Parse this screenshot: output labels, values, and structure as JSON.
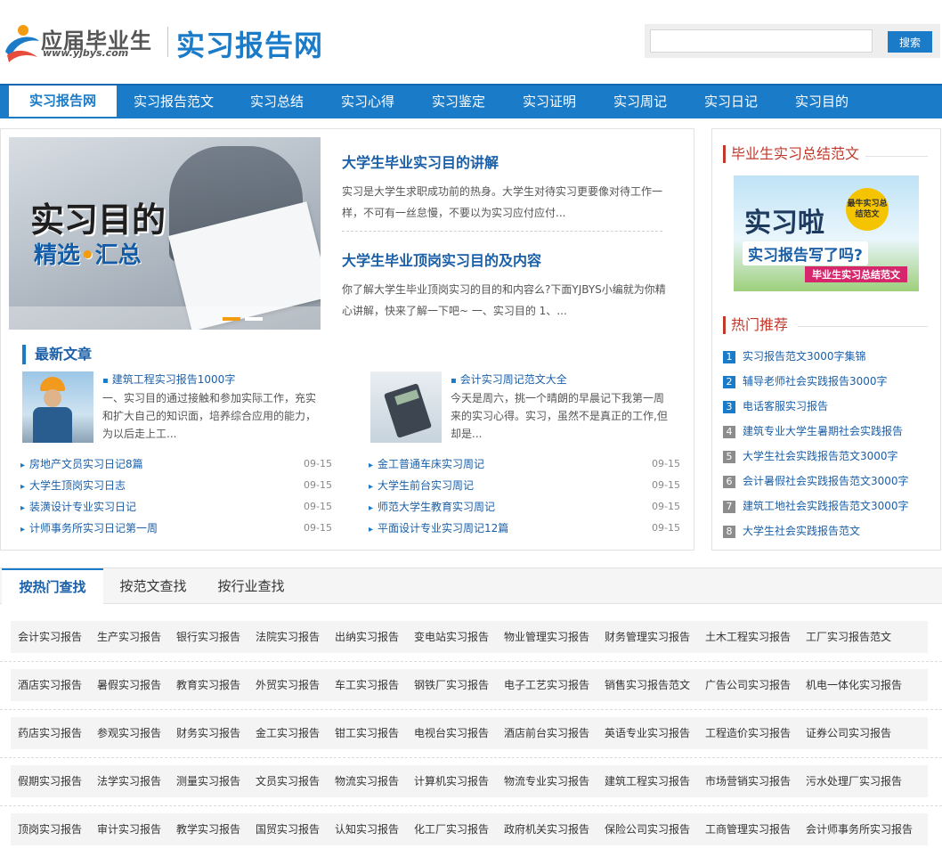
{
  "header": {
    "logo_main": "应届毕业生",
    "logo_sub": "www.yjbys.com",
    "site_title": "实习报告网",
    "search_placeholder": "",
    "search_button": "搜索",
    "colors": {
      "brand": "#1a7bc9",
      "accent_red": "#c0392b"
    }
  },
  "nav": {
    "items": [
      {
        "label": "实习报告网",
        "active": true
      },
      {
        "label": "实习报告范文"
      },
      {
        "label": "实习总结"
      },
      {
        "label": "实习心得"
      },
      {
        "label": "实习鉴定"
      },
      {
        "label": "实习证明"
      },
      {
        "label": "实习周记"
      },
      {
        "label": "实习日记"
      },
      {
        "label": "实习目的"
      }
    ]
  },
  "banner": {
    "title": "实习目的",
    "subtitle_a": "精选",
    "subtitle_b": "汇总"
  },
  "features": [
    {
      "title": "大学生毕业实习目的讲解",
      "desc": "实习是大学生求职成功前的热身。大学生对待实习更要像对待工作一样，不可有一丝怠慢，不要以为实习应付应付..."
    },
    {
      "title": "大学生毕业顶岗实习目的及内容",
      "desc": "你了解大学生毕业顶岗实习的目的和内容么?下面YJBYS小编就为你精心讲解，快来了解一下吧~ 一、实习目的 1、..."
    }
  ],
  "latest": {
    "heading": "最新文章",
    "cards": [
      {
        "title": "建筑工程实习报告1000字",
        "desc": "一、实习目的通过接触和参加实际工作，充实和扩大自己的知识面，培养综合应用的能力，为以后走上工...",
        "icon": "construction-worker-icon"
      },
      {
        "title": "会计实习周记范文大全",
        "desc": "今天是周六，挑一个晴朗的早晨记下我第一周来的实习心得。实习，虽然不是真正的工作,但却是...",
        "icon": "calculator-icon"
      }
    ],
    "list_left": [
      {
        "title": "房地产文员实习日记8篇",
        "date": "09-15"
      },
      {
        "title": "大学生顶岗实习日志",
        "date": "09-15"
      },
      {
        "title": "装潢设计专业实习日记",
        "date": "09-15"
      },
      {
        "title": "计师事务所实习日记第一周",
        "date": "09-15"
      }
    ],
    "list_right": [
      {
        "title": "金工普通车床实习周记",
        "date": "09-15"
      },
      {
        "title": "大学生前台实习周记",
        "date": "09-15"
      },
      {
        "title": "师范大学生教育实习周记",
        "date": "09-15"
      },
      {
        "title": "平面设计专业实习周记12篇",
        "date": "09-15"
      }
    ]
  },
  "sidebar": {
    "summary_heading": "毕业生实习总结范文",
    "side_banner": {
      "title": "实习啦",
      "question": "实习报告写了吗?",
      "badge": "最牛实习总结范文",
      "strip": "毕业生实习总结范文"
    },
    "hot_heading": "热门推荐",
    "hot": [
      {
        "num": "1",
        "title": "实习报告范文3000字集锦"
      },
      {
        "num": "2",
        "title": "辅导老师社会实践报告3000字"
      },
      {
        "num": "3",
        "title": "电话客服实习报告"
      },
      {
        "num": "4",
        "title": "建筑专业大学生暑期社会实践报告"
      },
      {
        "num": "5",
        "title": "大学生社会实践报告范文3000字"
      },
      {
        "num": "6",
        "title": "会计暑假社会实践报告范文3000字"
      },
      {
        "num": "7",
        "title": "建筑工地社会实践报告范文3000字"
      },
      {
        "num": "8",
        "title": "大学生社会实践报告范文"
      }
    ]
  },
  "tabs": {
    "items": [
      {
        "label": "按热门查找",
        "active": true
      },
      {
        "label": "按范文查找"
      },
      {
        "label": "按行业查找"
      }
    ],
    "rows": [
      [
        "会计实习报告",
        "生产实习报告",
        "银行实习报告",
        "法院实习报告",
        "出纳实习报告",
        "变电站实习报告",
        "物业管理实习报告",
        "财务管理实习报告",
        "土木工程实习报告",
        "工厂实习报告范文"
      ],
      [
        "酒店实习报告",
        "暑假实习报告",
        "教育实习报告",
        "外贸实习报告",
        "车工实习报告",
        "钢铁厂实习报告",
        "电子工艺实习报告",
        "销售实习报告范文",
        "广告公司实习报告",
        "机电一体化实习报告"
      ],
      [
        "药店实习报告",
        "参观实习报告",
        "财务实习报告",
        "金工实习报告",
        "钳工实习报告",
        "电视台实习报告",
        "酒店前台实习报告",
        "英语专业实习报告",
        "工程造价实习报告",
        "证券公司实习报告"
      ],
      [
        "假期实习报告",
        "法学实习报告",
        "测量实习报告",
        "文员实习报告",
        "物流实习报告",
        "计算机实习报告",
        "物流专业实习报告",
        "建筑工程实习报告",
        "市场营销实习报告",
        "污水处理厂实习报告"
      ],
      [
        "顶岗实习报告",
        "审计实习报告",
        "教学实习报告",
        "国贸实习报告",
        "认知实习报告",
        "化工厂实习报告",
        "政府机关实习报告",
        "保险公司实习报告",
        "工商管理实习报告",
        "会计师事务所实习报告"
      ]
    ]
  }
}
